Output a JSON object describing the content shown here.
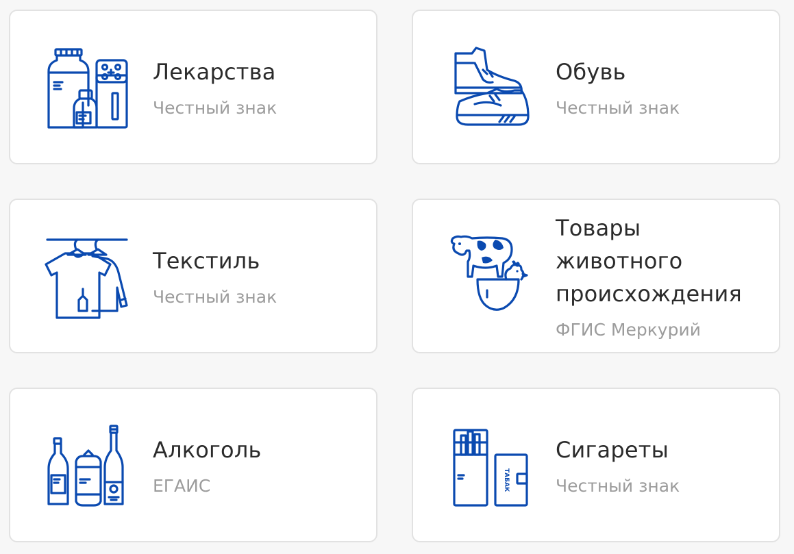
{
  "accent_color": "#0b4ab0",
  "cards": [
    {
      "title": "Лекарства",
      "subtitle": "Честный знак",
      "icon": "medicine-icon"
    },
    {
      "title": "Обувь",
      "subtitle": "Честный знак",
      "icon": "shoes-icon"
    },
    {
      "title": "Текстиль",
      "subtitle": "Честный знак",
      "icon": "textile-icon"
    },
    {
      "title": "Товары животного происхождения",
      "subtitle": "ФГИС Меркурий",
      "icon": "animal-products-icon"
    },
    {
      "title": "Алкоголь",
      "subtitle": "ЕГАИС",
      "icon": "alcohol-icon"
    },
    {
      "title": "Сигареты",
      "subtitle": "Честный знак",
      "icon": "cigarettes-icon",
      "icon_text": "ТАБАК"
    }
  ]
}
